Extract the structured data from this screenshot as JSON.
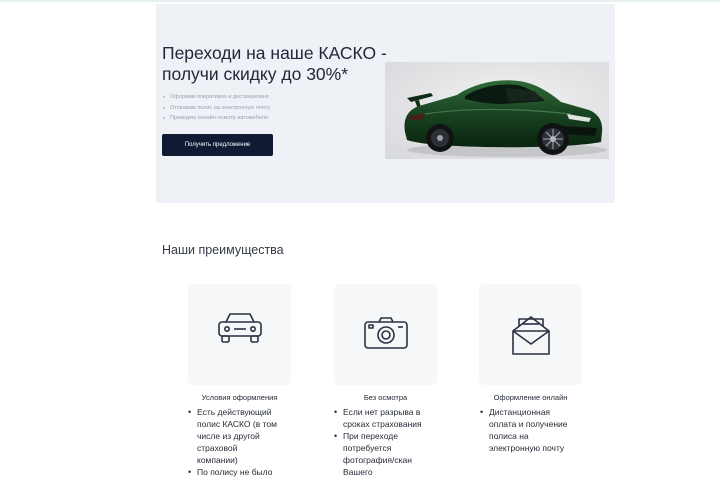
{
  "hero": {
    "title_line1": "Переходи на наше КАСКО -",
    "title_line2": "получи скидку до 30%*",
    "bullets": [
      "Оформим оперативно и дистанционно",
      "Отправим полис на электронную почту",
      "Проведем онлайн-осмотр автомобиля"
    ],
    "button_label": "Получить предложение",
    "image_icon": "sports-car-image"
  },
  "advantages": {
    "title": "Наши преимущества",
    "cards": [
      {
        "icon": "car-icon",
        "caption": "Условия оформления",
        "items": [
          "Есть действующий полис КАСКО (в том числе из другой страховой компании)",
          "По полису не было"
        ]
      },
      {
        "icon": "camera-icon",
        "caption": "Без осмотра",
        "items": [
          "Если нет разрыва в сроках страхования",
          "При переходе потребуется фотография/скан Вашего"
        ]
      },
      {
        "icon": "envelope-icon",
        "caption": "Оформление онлайн",
        "items": [
          "Дистанционная оплата и получение полиса на электронную почту"
        ]
      }
    ]
  },
  "colors": {
    "hero_background": "#eef1f6",
    "button_background": "#111a33",
    "card_background": "#f6f7f9",
    "icon_stroke": "#2b3143",
    "car_body": "#1d4a26"
  }
}
